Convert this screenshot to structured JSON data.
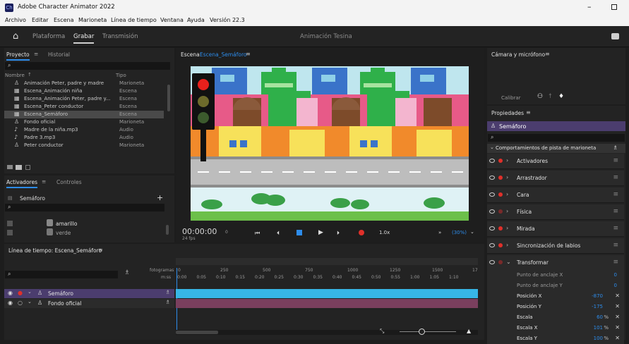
{
  "app": {
    "title": "Adobe Character Animator 2022",
    "menu": [
      "Archivo",
      "Editar",
      "Escena",
      "Marioneta",
      "Línea de tiempo",
      "Ventana",
      "Ayuda",
      "Versión 22.3"
    ]
  },
  "appbar": {
    "tabs": [
      "Plataforma",
      "Grabar",
      "Transmisión"
    ],
    "active_tab": "Grabar",
    "doc_title": "Animación Tesina"
  },
  "project": {
    "tabs": [
      "Proyecto",
      "Historial"
    ],
    "col_name": "Nombre",
    "col_type": "Tipo",
    "items": [
      {
        "name": "Animación Peter, padre y madre",
        "type": "Marioneta"
      },
      {
        "name": "Escena_Animación niña",
        "type": "Escena"
      },
      {
        "name": "Escena_Animación Peter, padre y...",
        "type": "Escena"
      },
      {
        "name": "Escena_Peter conductor",
        "type": "Escena"
      },
      {
        "name": "Escena_Semáforo",
        "type": "Escena"
      },
      {
        "name": "Fondo oficial",
        "type": "Marioneta"
      },
      {
        "name": "Madre de la niña.mp3",
        "type": "Audio"
      },
      {
        "name": "Padre 3.mp3",
        "type": "Audio"
      },
      {
        "name": "Peter conductor",
        "type": "Marioneta"
      }
    ],
    "selected_index": 4
  },
  "triggers": {
    "tabs": [
      "Activadores",
      "Controles"
    ],
    "puppet": "Semáforo",
    "items": [
      "amarillo",
      "verde"
    ]
  },
  "scene": {
    "label": "Escena:",
    "name": "Escena_Semáforo",
    "timecode": "00:00:00",
    "timecode_frame": "0",
    "fps": "24 fps",
    "speed": "1.0x",
    "zoom": "(30%)"
  },
  "timeline": {
    "title": "Línea de tiempo: Escena_Semáforo",
    "frames_label": "fotogramas",
    "ms_label": "m:ss",
    "frame_ticks": [
      "0",
      "250",
      "500",
      "750",
      "1000",
      "1250",
      "1500",
      "17"
    ],
    "time_ticks": [
      "0:00",
      "0:05",
      "0:10",
      "0:15",
      "0:20",
      "0:25",
      "0:30",
      "0:35",
      "0:40",
      "0:45",
      "0:50",
      "0:55",
      "1:00",
      "1:05",
      "1:10"
    ],
    "tracks": [
      {
        "name": "Semáforo",
        "color": "#37b6e6"
      },
      {
        "name": "Fondo oficial",
        "color": "#7a3f5e"
      }
    ]
  },
  "camera": {
    "title": "Cámara y micrófono",
    "calibrate": "Calibrar"
  },
  "properties": {
    "title": "Propiedades",
    "puppet": "Semáforo",
    "section": "Comportamientos de pista de marioneta",
    "behaviors": [
      "Activadores",
      "Arrastrador",
      "Cara",
      "Física",
      "Mirada",
      "Sincronización de labios",
      "Transformar"
    ],
    "transform": [
      {
        "label": "Punto de anclaje X",
        "value": "0"
      },
      {
        "label": "Punto de anclaje Y",
        "value": "0"
      },
      {
        "label": "Posición X",
        "value": "-870",
        "unit": ""
      },
      {
        "label": "Posición Y",
        "value": "-175",
        "unit": ""
      },
      {
        "label": "Escala",
        "value": "60",
        "unit": "%"
      },
      {
        "label": "Escala X",
        "value": "101",
        "unit": "%"
      },
      {
        "label": "Escala Y",
        "value": "100",
        "unit": "%"
      }
    ]
  }
}
